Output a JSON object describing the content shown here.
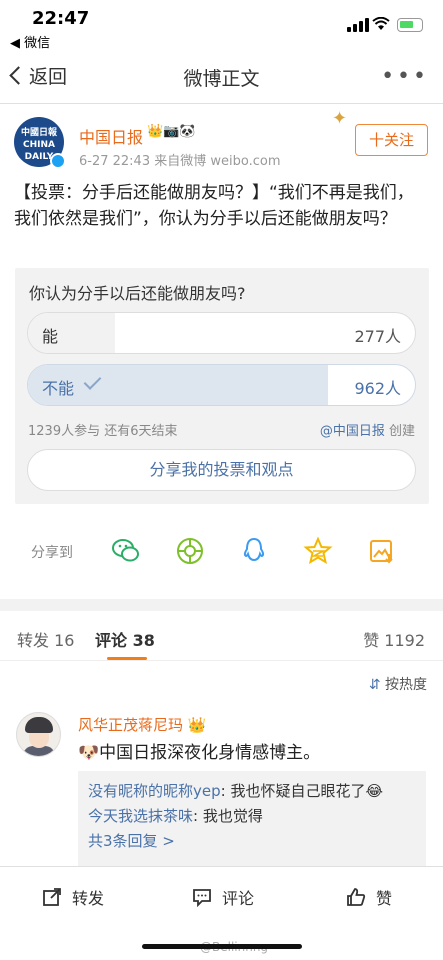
{
  "status_bar": {
    "time": "22:47",
    "back_app": "◀ 微信"
  },
  "nav": {
    "back_label": "返回",
    "title": "微博正文",
    "more": "•••"
  },
  "author": {
    "avatar_text": "中國日報 CHINA DAILY",
    "name": "中国日报",
    "badges": "👑📷🐼",
    "meta": "6-27 22:43  来自微博 weibo.com",
    "follow_label": "十关注"
  },
  "post": {
    "text": "【投票：分手后还能做朋友吗？】“我们不再是我们，我们依然是我们”，你认为分手以后还能做朋友吗？"
  },
  "poll": {
    "question": "你认为分手以后还能做朋友吗?",
    "options": [
      {
        "label": "能",
        "count": "277人",
        "fraction": 0.224,
        "selected": false
      },
      {
        "label": "不能",
        "count": "962人",
        "fraction": 0.776,
        "selected": true
      }
    ],
    "stats": "1239人参与   还有6天结束",
    "creator_name": "@中国日报",
    "creator_suffix": " 创建",
    "share_label": "分享我的投票和观点"
  },
  "share": {
    "label": "分享到"
  },
  "tabs": {
    "repost": "转发 16",
    "comments": "评论 38",
    "likes": "赞 1192"
  },
  "sort_label": "按热度",
  "comment": {
    "name": "风华正茂蒋尼玛",
    "name_badge": "👑",
    "text": "🐶中国日报深夜化身情感博主。",
    "replies": [
      {
        "user": "没有昵称的昵称yep",
        "text": ": 我也怀疑自己眼花了😂"
      },
      {
        "user": "今天我选抹茶味",
        "text": ": 我也觉得"
      }
    ],
    "more_replies": "共3条回复 >"
  },
  "bottom_bar": {
    "repost": "转发",
    "comment": "评论",
    "like": "赞"
  },
  "watermark": "@Bellinnng",
  "colors": {
    "accent_orange": "#e86b1c",
    "link_blue": "#4a72a8",
    "selected_fill": "#dde5ef"
  }
}
